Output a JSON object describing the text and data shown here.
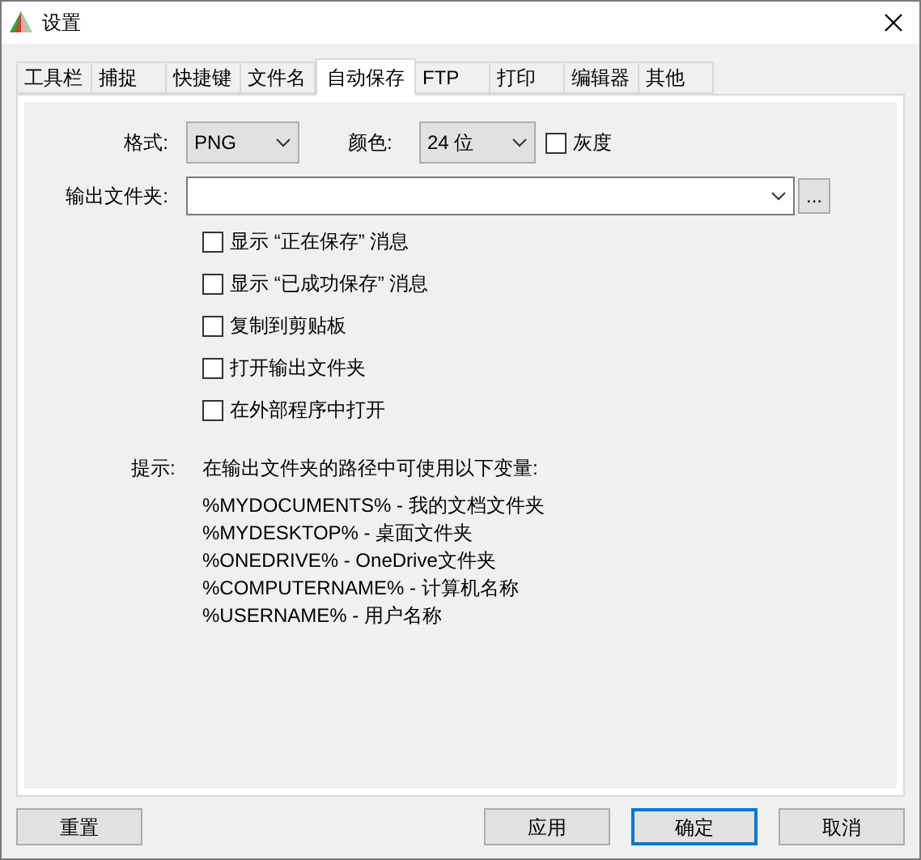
{
  "window": {
    "title": "设置"
  },
  "tabs": [
    {
      "label": "工具栏",
      "selected": false
    },
    {
      "label": "捕捉",
      "selected": false
    },
    {
      "label": "快捷键",
      "selected": false
    },
    {
      "label": "文件名",
      "selected": false
    },
    {
      "label": "自动保存",
      "selected": true
    },
    {
      "label": "FTP",
      "selected": false
    },
    {
      "label": "打印",
      "selected": false
    },
    {
      "label": "编辑器",
      "selected": false
    },
    {
      "label": "其他",
      "selected": false
    }
  ],
  "format": {
    "label": "格式:",
    "value": "PNG"
  },
  "color": {
    "label": "颜色:",
    "value": "24 位"
  },
  "grayscale": {
    "label": "灰度",
    "checked": false
  },
  "output_folder": {
    "label": "输出文件夹:",
    "browse": "..."
  },
  "options": [
    {
      "label": "显示 “正在保存” 消息",
      "checked": false
    },
    {
      "label": "显示 “已成功保存” 消息",
      "checked": false
    },
    {
      "label": "复制到剪贴板",
      "checked": false
    },
    {
      "label": "打开输出文件夹",
      "checked": false
    },
    {
      "label": "在外部程序中打开",
      "checked": false
    }
  ],
  "hint": {
    "label": "提示:",
    "intro": "在输出文件夹的路径中可使用以下变量:",
    "lines": [
      "%MYDOCUMENTS% - 我的文档文件夹",
      "%MYDESKTOP% - 桌面文件夹",
      "%ONEDRIVE% - OneDrive文件夹",
      "%COMPUTERNAME% - 计算机名称",
      "%USERNAME% - 用户名称"
    ]
  },
  "buttons": [
    {
      "label": "重置",
      "default": false
    },
    {
      "label": "应用",
      "default": false
    },
    {
      "label": "确定",
      "default": true
    },
    {
      "label": "取消",
      "default": false
    }
  ]
}
